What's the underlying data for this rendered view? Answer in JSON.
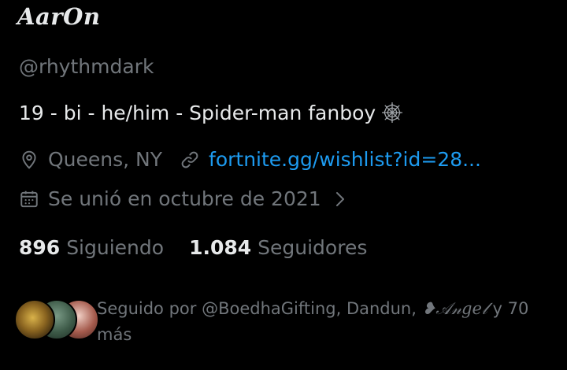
{
  "profile": {
    "display_name": "AarOn",
    "handle": "@rhythmdark",
    "bio": "19 - bi - he/him - Spider-man fanboy",
    "bio_emoji": "spider-web-icon",
    "location": "Queens, NY",
    "website": "fortnite.gg/wishlist?id=28...",
    "joined": "Se unió en octubre de 2021"
  },
  "stats": {
    "following_count": "896",
    "following_label": "Siguiendo",
    "followers_count": "1.084",
    "followers_label": "Seguidores"
  },
  "followed_by": {
    "prefix": "Seguido por @BoedhaGifting, Dandun,",
    "third_name": "❥𝒜𝓃𝑔𝑒𝓁",
    "suffix": "y 70 más"
  },
  "colors": {
    "background": "#000000",
    "primary_text": "#e7e9ea",
    "secondary_text": "#71767b",
    "link": "#1d9bf0"
  }
}
